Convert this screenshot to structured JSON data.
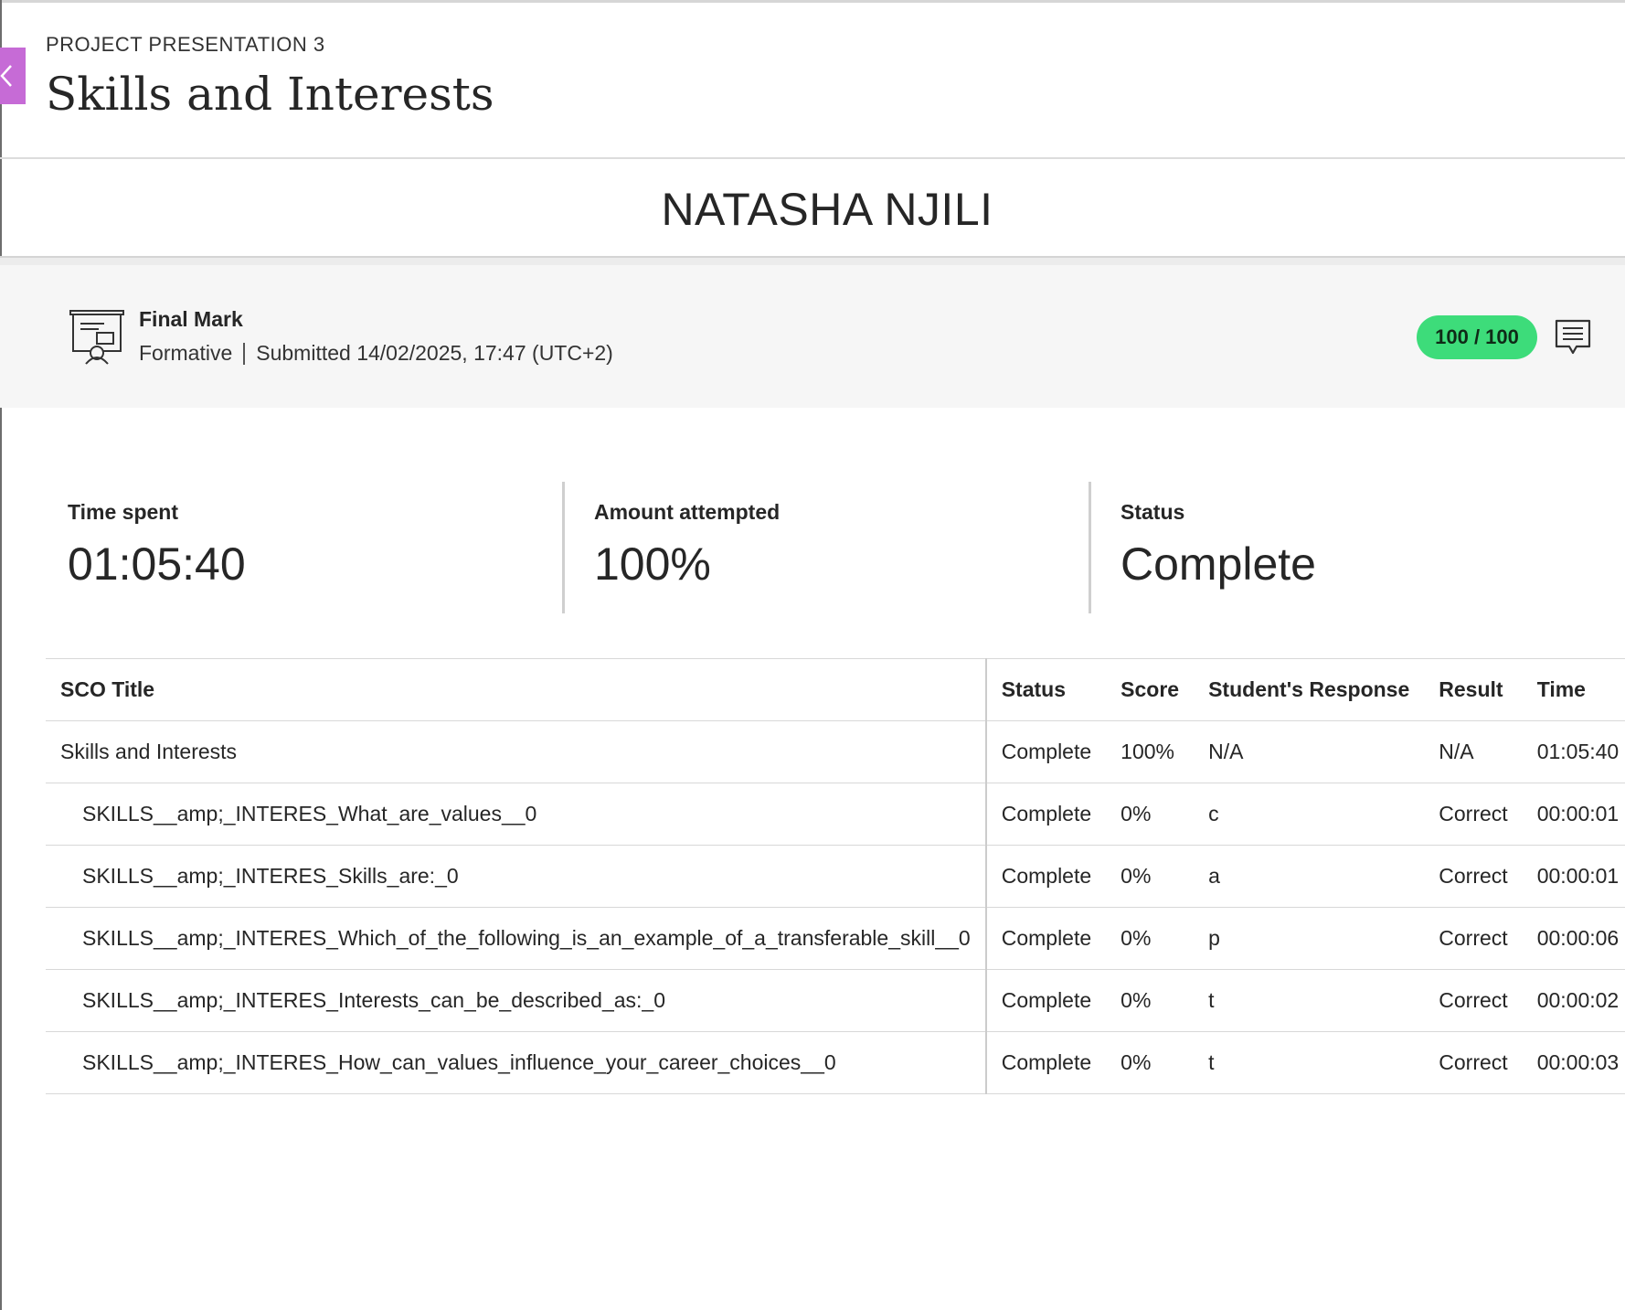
{
  "colors": {
    "accent": "#c66bd6",
    "score_pill": "#3ddc7a",
    "band_background": "#f6f6f6"
  },
  "header": {
    "eyebrow": "PROJECT PRESENTATION 3",
    "title": "Skills and Interests",
    "back_icon": "chevron-left-icon"
  },
  "student": {
    "name": "NATASHA NJILI"
  },
  "grade": {
    "icon": "presentation-board-icon",
    "label": "Final Mark",
    "type": "Formative",
    "submitted": "Submitted 14/02/2025, 17:47 (UTC+2)",
    "score": "100 / 100",
    "feedback_icon": "feedback-comment-icon"
  },
  "stats": [
    {
      "label": "Time spent",
      "value": "01:05:40"
    },
    {
      "label": "Amount attempted",
      "value": "100%"
    },
    {
      "label": "Status",
      "value": "Complete"
    }
  ],
  "table": {
    "columns": [
      "SCO Title",
      "Status",
      "Score",
      "Student's Response",
      "Result",
      "Time"
    ],
    "rows": [
      {
        "title": "Skills and Interests",
        "status": "Complete",
        "score": "100%",
        "response": "N/A",
        "result": "N/A",
        "time": "01:05:40"
      },
      {
        "title": "SKILLS__amp;_INTERES_What_are_values__0",
        "status": "Complete",
        "score": "0%",
        "response": "c",
        "result": "Correct",
        "time": "00:00:01"
      },
      {
        "title": "SKILLS__amp;_INTERES_Skills_are:_0",
        "status": "Complete",
        "score": "0%",
        "response": "a",
        "result": "Correct",
        "time": "00:00:01"
      },
      {
        "title": "SKILLS__amp;_INTERES_Which_of_the_following_is_an_example_of_a_transferable_skill__0",
        "status": "Complete",
        "score": "0%",
        "response": "p",
        "result": "Correct",
        "time": "00:00:06"
      },
      {
        "title": "SKILLS__amp;_INTERES_Interests_can_be_described_as:_0",
        "status": "Complete",
        "score": "0%",
        "response": "t",
        "result": "Correct",
        "time": "00:00:02"
      },
      {
        "title": "SKILLS__amp;_INTERES_How_can_values_influence_your_career_choices__0",
        "status": "Complete",
        "score": "0%",
        "response": "t",
        "result": "Correct",
        "time": "00:00:03"
      }
    ]
  }
}
